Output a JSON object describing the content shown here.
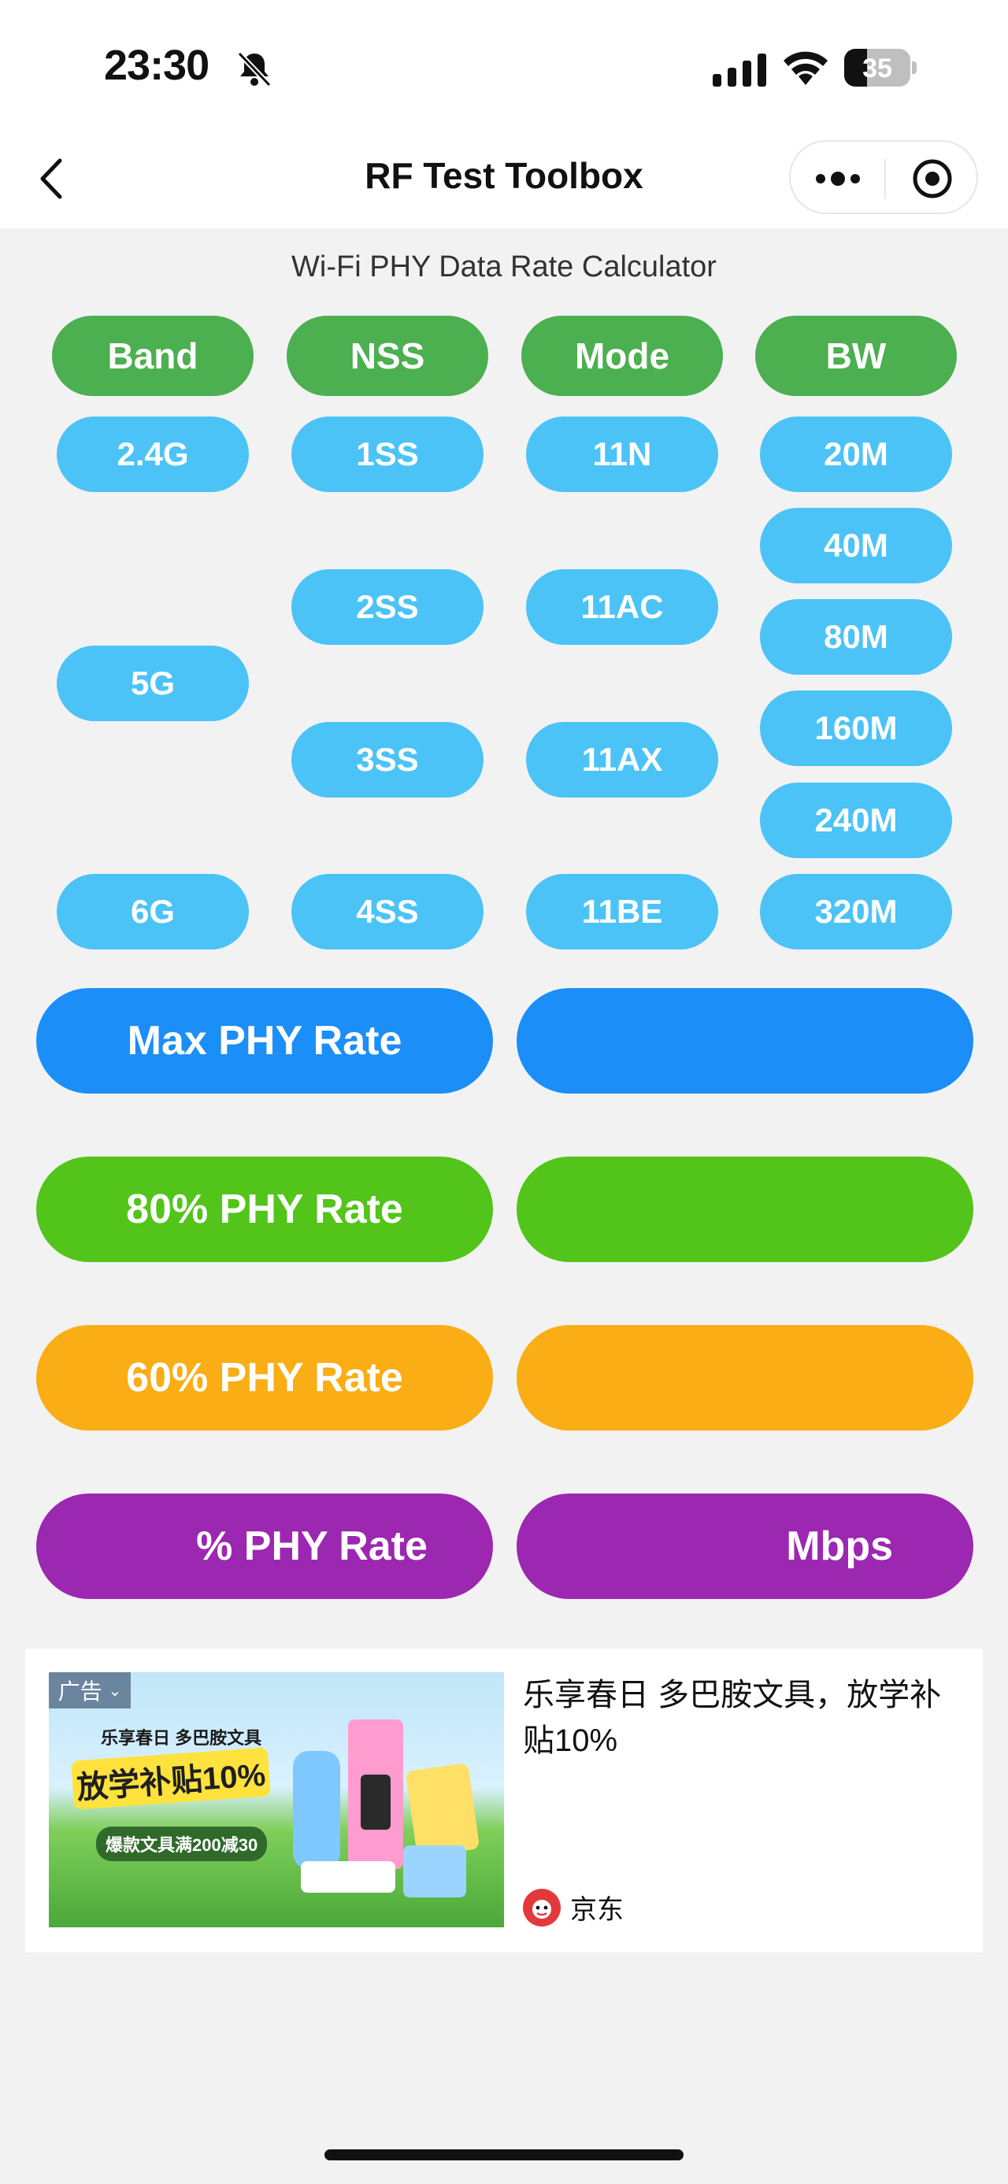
{
  "status_bar": {
    "time": "23:30",
    "battery": "35",
    "battery_level": 0.35
  },
  "nav": {
    "title": "RF Test Toolbox"
  },
  "calculator": {
    "subtitle": "Wi-Fi PHY Data Rate Calculator",
    "headers": [
      "Band",
      "NSS",
      "Mode",
      "BW"
    ],
    "band_options": [
      "2.4G",
      "5G",
      "6G"
    ],
    "nss_options": [
      "1SS",
      "2SS",
      "3SS",
      "4SS"
    ],
    "mode_options": [
      "11N",
      "11AC",
      "11AX",
      "11BE"
    ],
    "bw_options": [
      "20M",
      "40M",
      "80M",
      "160M",
      "240M",
      "320M"
    ]
  },
  "results": {
    "max_label": "Max PHY Rate",
    "max_value": "",
    "p80_label": "80% PHY Rate",
    "p80_value": "",
    "p60_label": "60% PHY Rate",
    "p60_value": "",
    "custom_label": "% PHY Rate",
    "custom_value": "Mbps"
  },
  "colors": {
    "header_green": "#4caf50",
    "option_blue": "#4cc3f7",
    "max_blue": "#1b8ef8",
    "p80_green": "#52c41a",
    "p60_orange": "#faad14",
    "custom_purple": "#9c27b0"
  },
  "ad": {
    "tag": "广告",
    "image_line1": "乐享春日 多巴胺文具",
    "image_badge": "放学补贴10%",
    "image_line2": "爆款文具满200减30",
    "title": "乐享春日 多巴胺文具，放学补贴10%",
    "brand": "京东"
  }
}
